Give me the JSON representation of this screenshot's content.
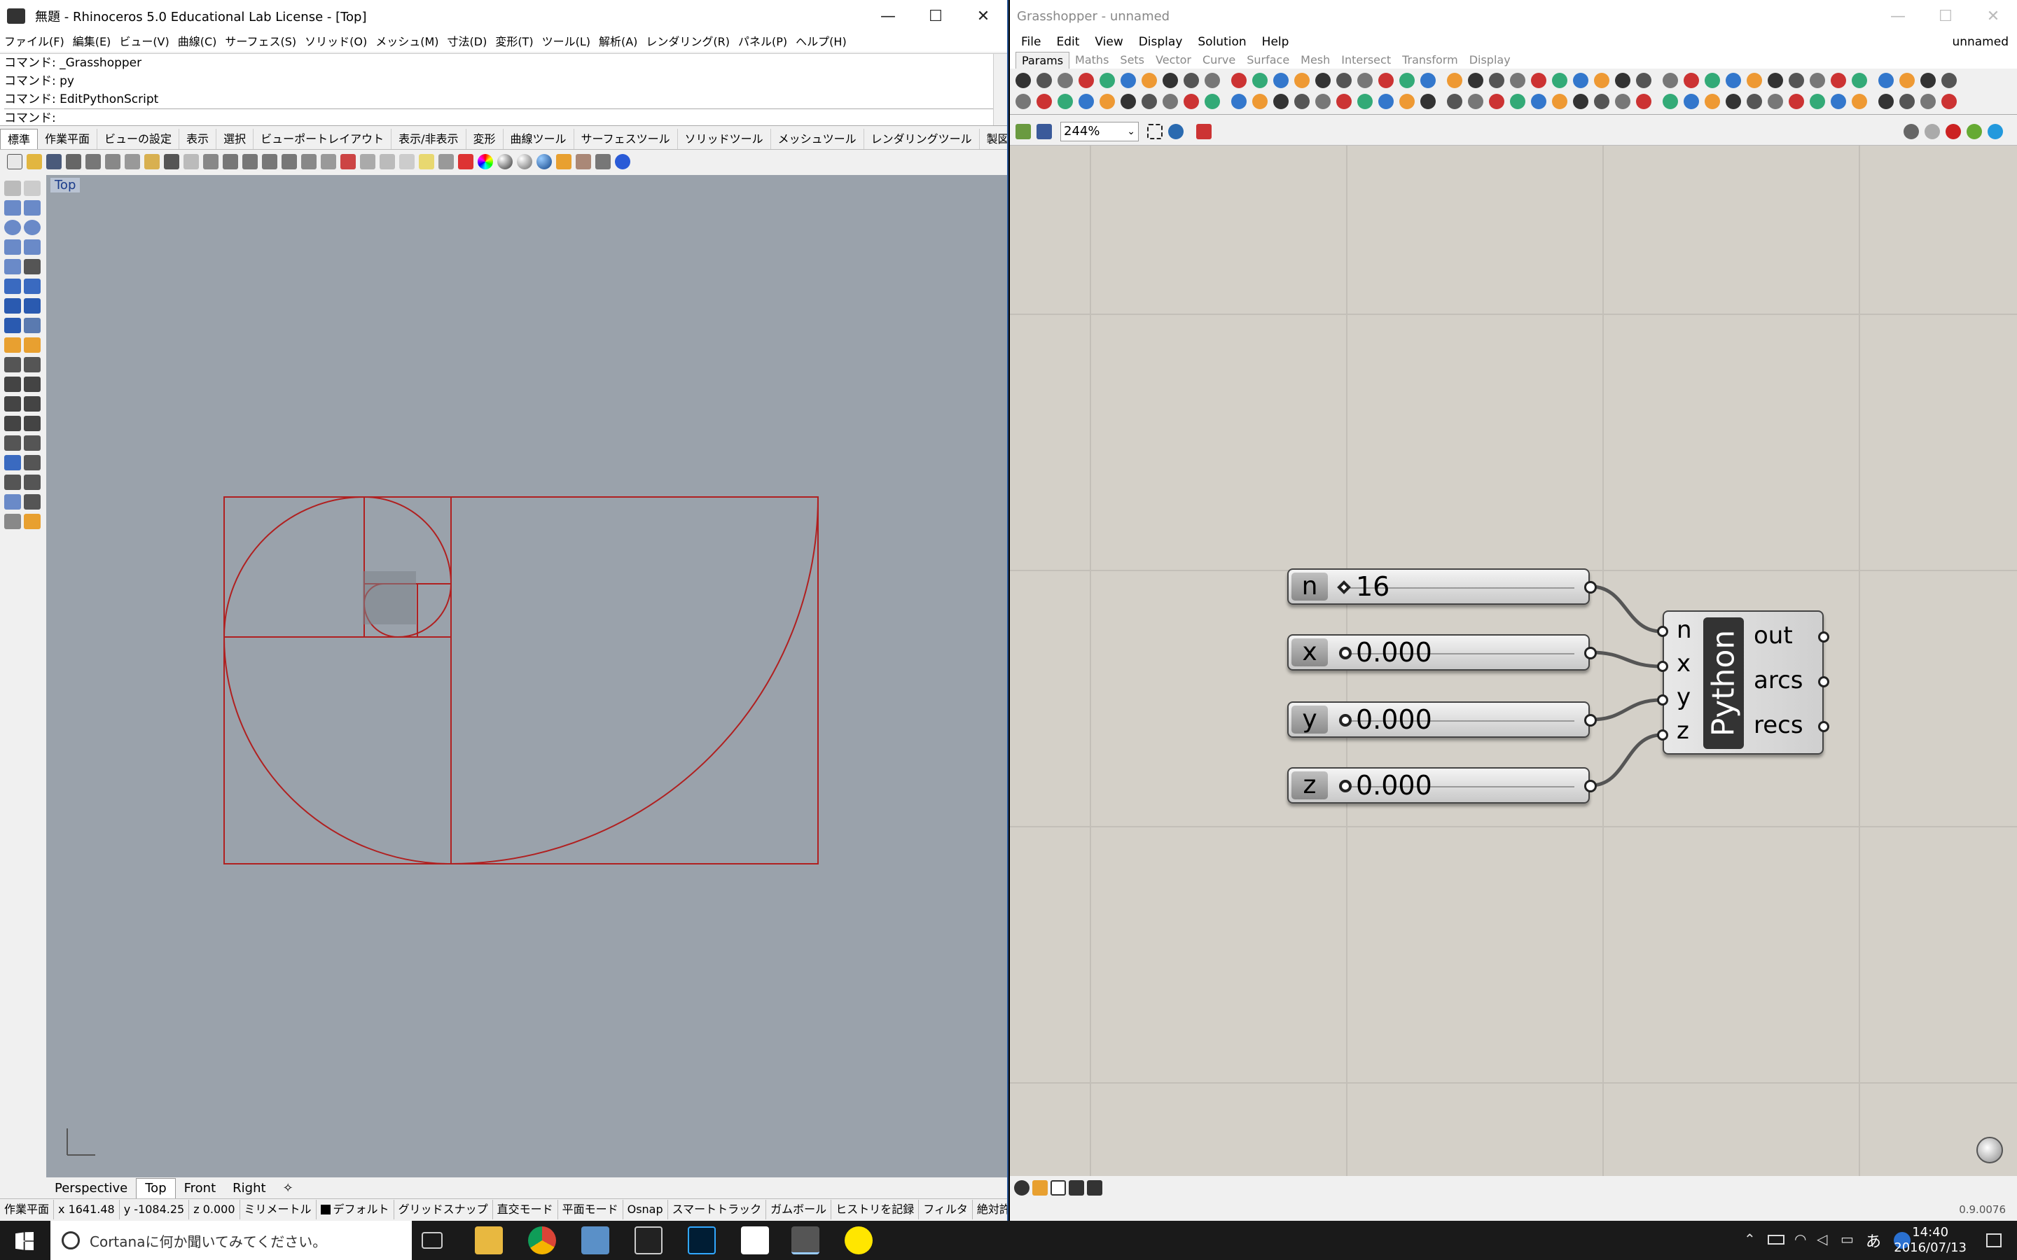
{
  "rhino": {
    "title": "無題 - Rhinoceros 5.0 Educational Lab License - [Top]",
    "menu": [
      "ファイル(F)",
      "編集(E)",
      "ビュー(V)",
      "曲線(C)",
      "サーフェス(S)",
      "ソリッド(O)",
      "メッシュ(M)",
      "寸法(D)",
      "変形(T)",
      "ツール(L)",
      "解析(A)",
      "レンダリング(R)",
      "パネル(P)",
      "ヘルプ(H)"
    ],
    "command_history": [
      "コマンド: _Grasshopper",
      "コマンド: py",
      "コマンド: EditPythonScript"
    ],
    "command_prompt": "コマンド:",
    "tabs": [
      "標準",
      "作業平面",
      "ビューの設定",
      "表示",
      "選択",
      "ビューポートレイアウト",
      "表示/非表示",
      "変形",
      "曲線ツール",
      "サーフェスツール",
      "ソリッドツール",
      "メッシュツール",
      "レンダリングツール",
      "製図"
    ],
    "viewport_label": "Top",
    "viewport_tabs": [
      "Perspective",
      "Top",
      "Front",
      "Right"
    ],
    "status": [
      "作業平面",
      "x 1641.48",
      "y -1084.25",
      "z 0.000",
      "ミリメートル",
      "デフォルト",
      "グリッドスナップ",
      "直交モード",
      "平面モード",
      "Osnap",
      "スマートトラック",
      "ガムボール",
      "ヒストリを記録",
      "フィルタ",
      "絶対許容差..."
    ]
  },
  "gh": {
    "title": "Grasshopper - unnamed",
    "doc_name": "unnamed",
    "menu": [
      "File",
      "Edit",
      "View",
      "Display",
      "Solution",
      "Help"
    ],
    "tabs": [
      "Params",
      "Maths",
      "Sets",
      "Vector",
      "Curve",
      "Surface",
      "Mesh",
      "Intersect",
      "Transform",
      "Display"
    ],
    "zoom": "244%",
    "sliders": [
      {
        "name": "n",
        "value": "16",
        "kind": "int"
      },
      {
        "name": "x",
        "value": "0.000",
        "kind": "float"
      },
      {
        "name": "y",
        "value": "0.000",
        "kind": "float"
      },
      {
        "name": "z",
        "value": "0.000",
        "kind": "float"
      }
    ],
    "python": {
      "label": "Python",
      "inputs": [
        "n",
        "x",
        "y",
        "z"
      ],
      "outputs": [
        "out",
        "arcs",
        "recs"
      ]
    },
    "version": "0.9.0076"
  },
  "taskbar": {
    "search_placeholder": "Cortanaに何か聞いてみてください。",
    "ime": "あ",
    "time": "14:40",
    "date": "2016/07/13"
  }
}
